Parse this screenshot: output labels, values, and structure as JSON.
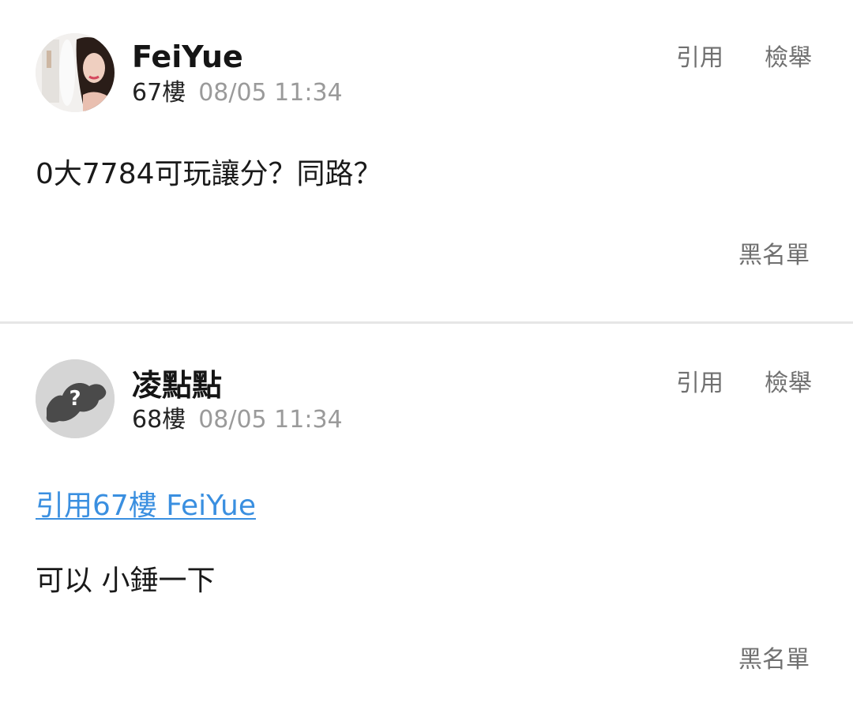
{
  "posts": [
    {
      "username": "FeiYue",
      "floor": "67樓",
      "timestamp": "08/05 11:34",
      "quote_label": "引用",
      "report_label": "檢舉",
      "content": "0大7784可玩讓分？同路？",
      "blacklist_label": "黑名單",
      "avatar": "user-photo-avatar"
    },
    {
      "username": "凌點點",
      "floor": "68樓",
      "timestamp": "08/05 11:34",
      "quote_label": "引用",
      "report_label": "檢舉",
      "quoted_ref": "引用67樓 FeiYue",
      "content": "可以 小錘一下",
      "blacklist_label": "黑名單",
      "avatar": "default-question-avatar"
    }
  ],
  "colors": {
    "link": "#3a8fe0",
    "muted": "#9a9a9a",
    "action": "#707070",
    "divider": "#e6e6e6"
  }
}
